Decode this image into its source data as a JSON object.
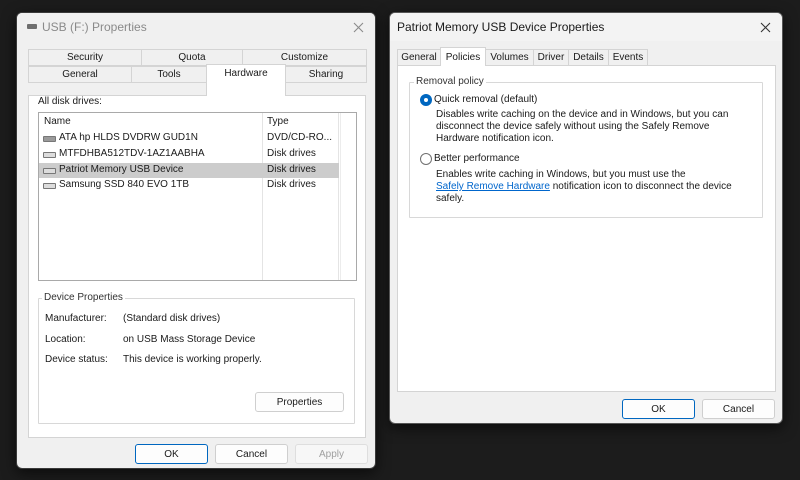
{
  "left_window": {
    "title": "USB (F:) Properties",
    "tabs_row1": [
      "Security",
      "Quota",
      "Customize"
    ],
    "tabs_row2": [
      "General",
      "Tools",
      "Hardware",
      "Sharing"
    ],
    "active_tab": "Hardware",
    "all_disk_drives_label": "All disk drives:",
    "columns": [
      "Name",
      "Type"
    ],
    "drives": [
      {
        "name": "ATA hp HLDS  DVDRW  GUD1N",
        "type": "DVD/CD-RO...",
        "icon": "cd-drive-icon"
      },
      {
        "name": "MTFDHBA512TDV-1AZ1AABHA",
        "type": "Disk drives",
        "icon": "disk-drive-icon"
      },
      {
        "name": "Patriot Memory USB Device",
        "type": "Disk drives",
        "icon": "disk-drive-icon",
        "selected": true
      },
      {
        "name": "Samsung SSD 840 EVO 1TB",
        "type": "Disk drives",
        "icon": "disk-drive-icon"
      }
    ],
    "device_properties": {
      "legend": "Device Properties",
      "manufacturer_label": "Manufacturer:",
      "manufacturer_value": "(Standard disk drives)",
      "location_label": "Location:",
      "location_value": "on USB Mass Storage Device",
      "status_label": "Device status:",
      "status_value": "This device is working properly.",
      "properties_button": "Properties"
    },
    "buttons": {
      "ok": "OK",
      "cancel": "Cancel",
      "apply": "Apply"
    }
  },
  "right_window": {
    "title": "Patriot Memory USB Device Properties",
    "tabs": [
      "General",
      "Policies",
      "Volumes",
      "Driver",
      "Details",
      "Events"
    ],
    "active_tab": "Policies",
    "removal_policy": {
      "legend": "Removal policy",
      "quick_label": "Quick removal (default)",
      "quick_selected": true,
      "quick_desc_line1": "Disables write caching on the device and in Windows, but you can",
      "quick_desc_line2": "disconnect the device safely without using the Safely Remove",
      "quick_desc_line3": "Hardware notification icon.",
      "better_label": "Better performance",
      "better_selected": false,
      "better_desc_line1": "Enables write caching in Windows, but you must use the",
      "better_desc_link": "Safely Remove Hardware",
      "better_desc_line2_rest": " notification icon to disconnect the device",
      "better_desc_line3": "safely."
    },
    "buttons": {
      "ok": "OK",
      "cancel": "Cancel"
    }
  },
  "colors": {
    "accent": "#0067c0",
    "link": "#0066cc",
    "selection": "#cccccc",
    "desktop": "#1c1c1c"
  }
}
